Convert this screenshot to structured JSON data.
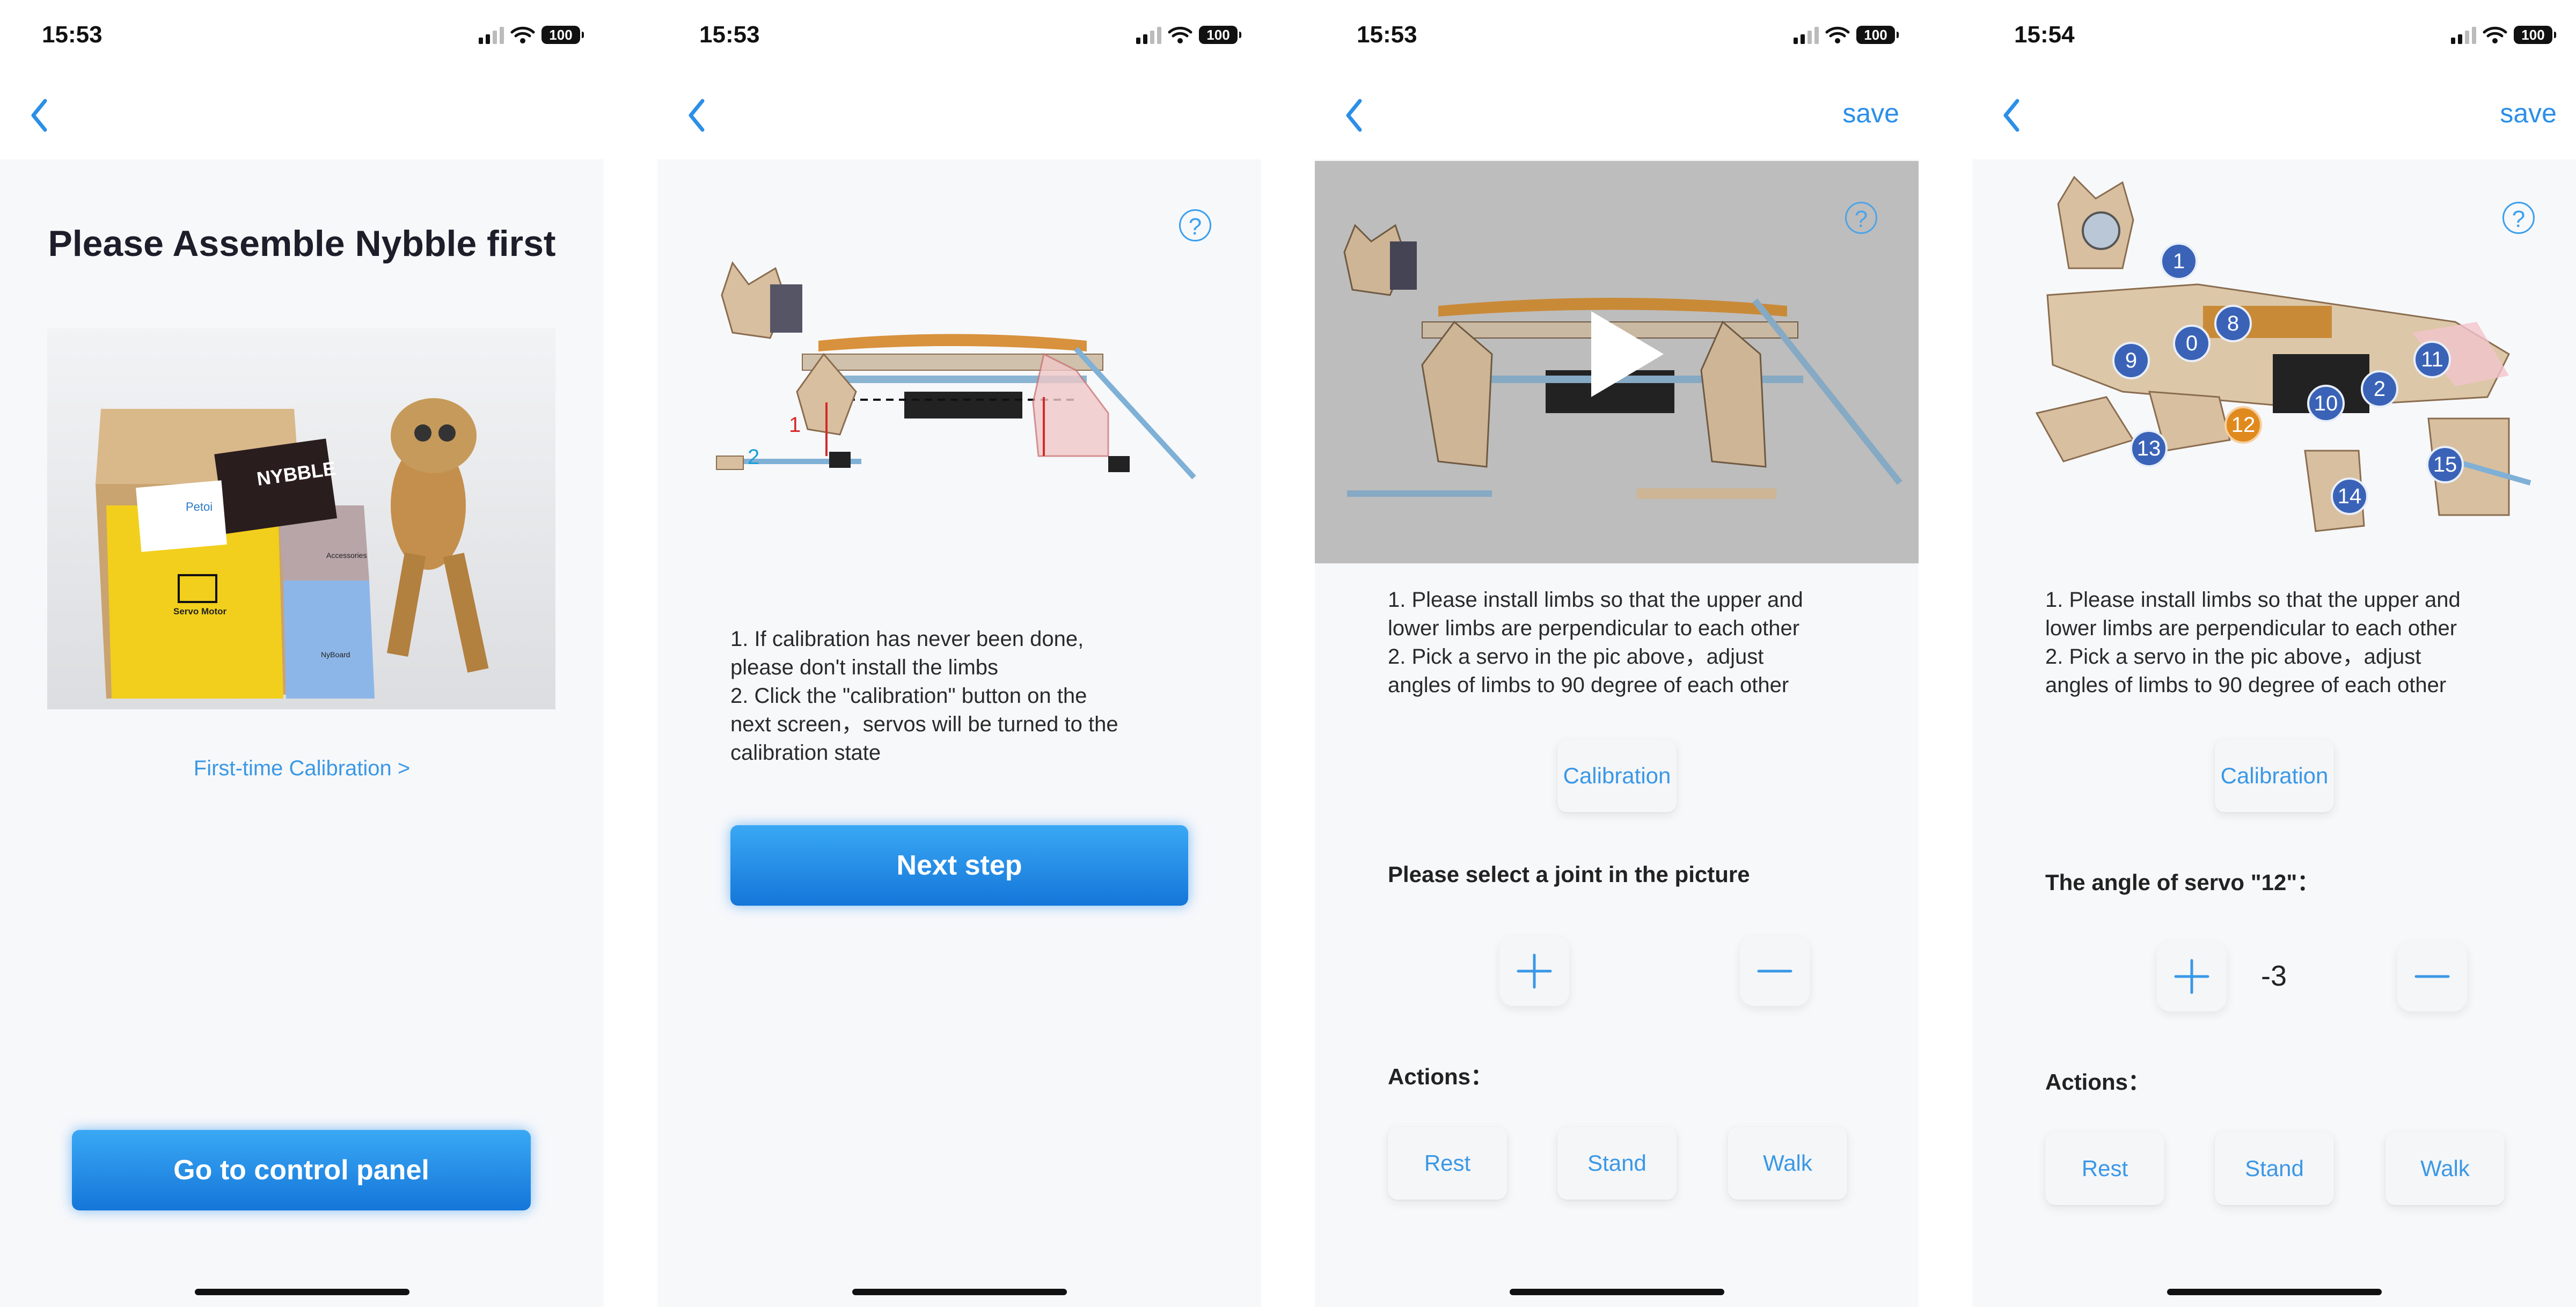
{
  "status": {
    "time1": "15:53",
    "time2": "15:53",
    "time3": "15:53",
    "time4": "15:54",
    "battery": "100"
  },
  "screen1": {
    "title": "Please Assemble Nybble first",
    "product_box_labels": [
      "Petoi",
      "NYBBLE",
      "Servo Motor",
      "Accessories",
      "NyBoard"
    ],
    "calibration_link": "First-time Calibration >",
    "control_button": "Go to control panel"
  },
  "screen2": {
    "help_icon": "?",
    "diagram_labels": [
      "1",
      "2"
    ],
    "instructions": "1. If calibration has never been done,\nplease don't install the limbs\n2. Click the \"calibration\" button on the\nnext screen，servos will be turned to the\ncalibration state",
    "next_button": "Next step"
  },
  "screen3": {
    "save": "save",
    "help_icon": "?",
    "instructions": "1. Please install limbs so that the upper and\nlower limbs are perpendicular to each other\n2. Pick a servo in the pic above，adjust\nangles of limbs to 90 degree of each other",
    "calibration_button": "Calibration",
    "select_prompt": "Please select a joint in the picture",
    "actions_label": "Actions：",
    "actions": [
      "Rest",
      "Stand",
      "Walk"
    ]
  },
  "screen4": {
    "save": "save",
    "help_icon": "?",
    "instructions": "1. Please install limbs so that the upper and\nlower limbs are perpendicular to each other\n2. Pick a servo in the pic above，adjust\nangles of limbs to 90 degree of each other",
    "calibration_button": "Calibration",
    "angle_prompt": "The angle of servo \"12\"：",
    "angle_value": "-3",
    "actions_label": "Actions：",
    "actions": [
      "Rest",
      "Stand",
      "Walk"
    ],
    "joints": [
      "1",
      "0",
      "8",
      "9",
      "11",
      "10",
      "2",
      "12",
      "13",
      "15",
      "14"
    ],
    "selected_joint": "12"
  },
  "colors": {
    "accent": "#2b8fe8",
    "badge": "#3a63b8",
    "selected_badge": "#e08a1e"
  }
}
